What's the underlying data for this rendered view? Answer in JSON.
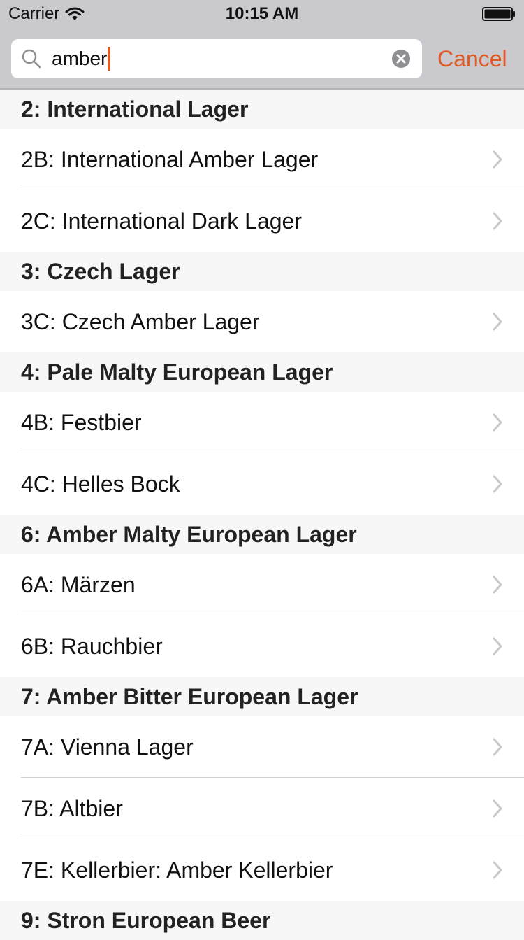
{
  "status_bar": {
    "carrier": "Carrier",
    "time": "10:15 AM"
  },
  "search": {
    "value": "amber",
    "cancel_label": "Cancel"
  },
  "colors": {
    "accent": "#de5a26",
    "bar_background": "#c9c9ce",
    "section_background": "#f7f7f7"
  },
  "sections": [
    {
      "title": "2: International Lager",
      "items": [
        {
          "label": "2B: International Amber Lager"
        },
        {
          "label": "2C: International Dark Lager"
        }
      ]
    },
    {
      "title": "3: Czech Lager",
      "items": [
        {
          "label": "3C: Czech Amber Lager"
        }
      ]
    },
    {
      "title": "4: Pale Malty European Lager",
      "items": [
        {
          "label": "4B: Festbier"
        },
        {
          "label": "4C: Helles Bock"
        }
      ]
    },
    {
      "title": "6: Amber Malty European Lager",
      "items": [
        {
          "label": "6A: Märzen"
        },
        {
          "label": "6B: Rauchbier"
        }
      ]
    },
    {
      "title": "7: Amber Bitter European Lager",
      "items": [
        {
          "label": "7A: Vienna Lager"
        },
        {
          "label": "7B: Altbier"
        },
        {
          "label": "7E: Kellerbier: Amber Kellerbier"
        }
      ]
    },
    {
      "title": "9: Stron European Beer",
      "items": []
    }
  ]
}
